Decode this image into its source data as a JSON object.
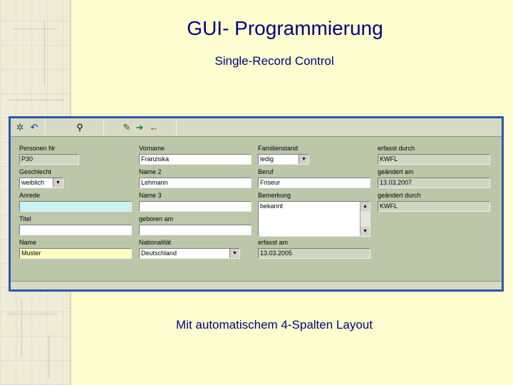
{
  "slide": {
    "title": "GUI- Programmierung",
    "subtitle": "Single-Record Control",
    "caption": "Mit automatischem 4-Spalten Layout"
  },
  "toolbar": {
    "icons": [
      "settings-icon",
      "undo-icon",
      "search-icon",
      "edit-icon",
      "add-icon",
      "delete-icon"
    ]
  },
  "form": {
    "col1": {
      "personen_nr_label": "Personen Nr",
      "personen_nr_value": "P30",
      "geschlecht_label": "Geschlecht",
      "geschlecht_value": "weiblich",
      "anrede_label": "Anrede",
      "anrede_value": "",
      "titel_label": "Titel",
      "titel_value": "",
      "name_label": "Name",
      "name_value": "Muster"
    },
    "col2": {
      "vorname_label": "Vorname",
      "vorname_value": "Franziska",
      "name2_label": "Name 2",
      "name2_value": "Lehmann",
      "name3_label": "Name 3",
      "name3_value": "",
      "geboren_label": "geboren am",
      "geboren_value": "",
      "nationalitaet_label": "Nationalität",
      "nationalitaet_value": "Deutschland"
    },
    "col3": {
      "familienstand_label": "Familienstand",
      "familienstand_value": "ledig",
      "beruf_label": "Beruf",
      "beruf_value": "Friseur",
      "bemerkung_label": "Bemerkung",
      "bemerkung_value": "bekannt",
      "erfasst_am_label": "erfasst am",
      "erfasst_am_value": "13.03.2005"
    },
    "col4": {
      "erfasst_durch_label": "erfasst durch",
      "erfasst_durch_value": "KWFL",
      "geaendert_am_label": "geändert am",
      "geaendert_am_value": "13.03.2007",
      "geaendert_durch_label": "geändert durch",
      "geaendert_durch_value": "KWFL"
    }
  },
  "colors": {
    "slide_background": "#fefdd0",
    "title_text": "#000080",
    "window_frame": "#2c56a8",
    "form_background": "#bcc6a8"
  }
}
